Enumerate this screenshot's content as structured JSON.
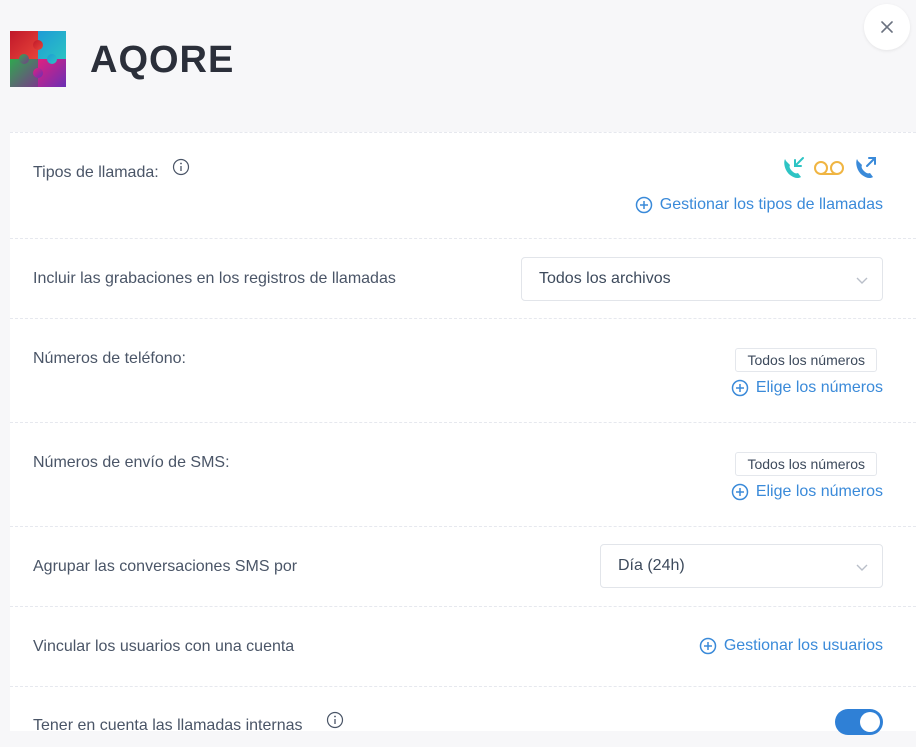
{
  "header": {
    "brand": "AQORE"
  },
  "settings": {
    "call_types": {
      "label": "Tipos de llamada:",
      "link": "Gestionar los tipos de llamadas"
    },
    "recordings": {
      "label": "Incluir las grabaciones en los registros de llamadas",
      "value": "Todos los archivos"
    },
    "phone_numbers": {
      "label": "Números de teléfono:",
      "chip": "Todos los números",
      "link": "Elige los números"
    },
    "sms_numbers": {
      "label": "Números de envío de SMS:",
      "chip": "Todos los números",
      "link": "Elige los números"
    },
    "group_sms": {
      "label": "Agrupar las conversaciones SMS por",
      "value": "Día (24h)"
    },
    "link_users": {
      "label": "Vincular los usuarios con una cuenta",
      "link": "Gestionar los usuarios"
    },
    "internal_calls": {
      "label": "Tener en cuenta las llamadas internas",
      "enabled": true
    }
  },
  "colors": {
    "accent": "#3a8ad9",
    "incoming": "#2ec4c4",
    "voicemail": "#f0b542",
    "outgoing": "#3a8ad9"
  },
  "icons": [
    "close-icon",
    "info-icon",
    "incoming-call-icon",
    "voicemail-icon",
    "outgoing-call-icon",
    "plus-circle-icon",
    "chevron-down-icon"
  ]
}
